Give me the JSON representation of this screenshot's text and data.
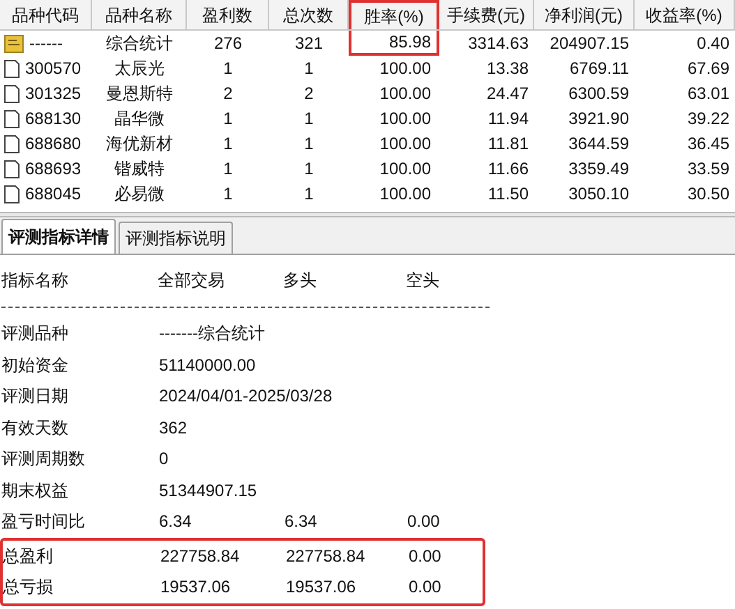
{
  "table": {
    "columns": [
      {
        "label": "品种代码",
        "highlighted": false
      },
      {
        "label": "品种名称",
        "highlighted": false
      },
      {
        "label": "盈利数",
        "highlighted": false
      },
      {
        "label": "总次数",
        "highlighted": false
      },
      {
        "label": "胜率(%)",
        "highlighted": true
      },
      {
        "label": "手续费(元)",
        "highlighted": false
      },
      {
        "label": "净利润(元)",
        "highlighted": false
      },
      {
        "label": "收益率(%)",
        "highlighted": false
      }
    ],
    "rows": [
      {
        "kind": "summary",
        "cells": [
          "------",
          "综合统计",
          "276",
          "321",
          "85.98",
          "3314.63",
          "204907.15",
          "0.40"
        ]
      },
      {
        "kind": "stock",
        "cells": [
          "300570",
          "太辰光",
          "1",
          "1",
          "100.00",
          "13.38",
          "6769.11",
          "67.69"
        ]
      },
      {
        "kind": "stock",
        "cells": [
          "301325",
          "曼恩斯特",
          "2",
          "2",
          "100.00",
          "24.47",
          "6300.59",
          "63.01"
        ]
      },
      {
        "kind": "stock",
        "cells": [
          "688130",
          "晶华微",
          "1",
          "1",
          "100.00",
          "11.94",
          "3921.90",
          "39.22"
        ]
      },
      {
        "kind": "stock",
        "cells": [
          "688680",
          "海优新材",
          "1",
          "1",
          "100.00",
          "11.81",
          "3644.59",
          "36.45"
        ]
      },
      {
        "kind": "stock",
        "cells": [
          "688693",
          "锴威特",
          "1",
          "1",
          "100.00",
          "11.66",
          "3359.49",
          "33.59"
        ]
      },
      {
        "kind": "stock",
        "cells": [
          "688045",
          "必易微",
          "1",
          "1",
          "100.00",
          "11.50",
          "3050.10",
          "30.50"
        ]
      }
    ]
  },
  "tabs": [
    {
      "label": "评测指标详情",
      "selected": true
    },
    {
      "label": "评测指标说明",
      "selected": false
    }
  ],
  "details": {
    "columns": [
      "指标名称",
      "全部交易",
      "多头",
      "空头"
    ],
    "rows": [
      {
        "cells": [
          "评测品种",
          "-------综合统计"
        ],
        "highlighted": false
      },
      {
        "cells": [
          "初始资金",
          "51140000.00"
        ],
        "highlighted": false
      },
      {
        "cells": [
          "评测日期",
          "2024/04/01-2025/03/28"
        ],
        "highlighted": false
      },
      {
        "cells": [
          "有效天数",
          "362"
        ],
        "highlighted": false
      },
      {
        "cells": [
          "评测周期数",
          "0"
        ],
        "highlighted": false
      },
      {
        "cells": [
          "期末权益",
          "51344907.15"
        ],
        "highlighted": false
      },
      {
        "cells": [
          "盈亏时间比",
          "6.34",
          "6.34",
          "0.00"
        ],
        "highlighted": false
      },
      {
        "cells": [
          "总盈利",
          "227758.84",
          "227758.84",
          "0.00"
        ],
        "highlighted": true
      },
      {
        "cells": [
          "总亏损",
          "19537.06",
          "19537.06",
          "0.00"
        ],
        "highlighted": true
      }
    ]
  }
}
